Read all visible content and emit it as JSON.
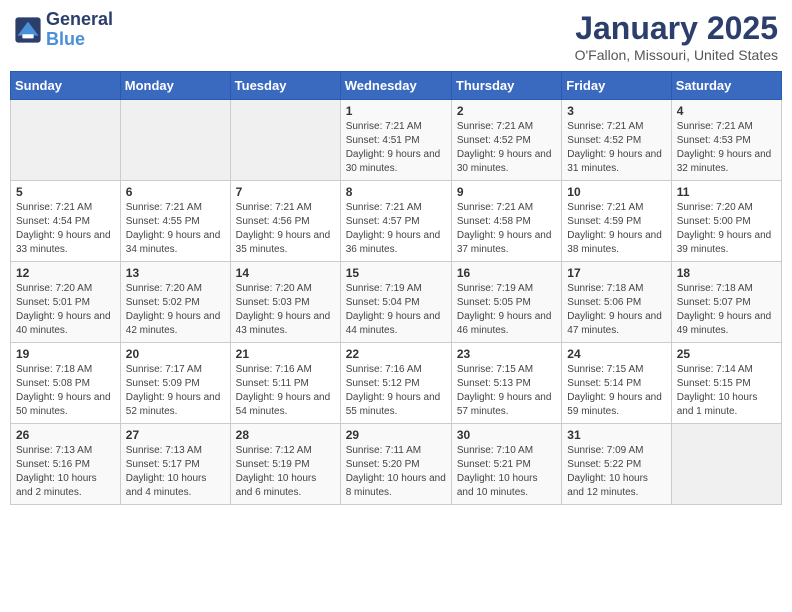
{
  "header": {
    "logo_line1": "General",
    "logo_line2": "Blue",
    "month": "January 2025",
    "location": "O'Fallon, Missouri, United States"
  },
  "weekdays": [
    "Sunday",
    "Monday",
    "Tuesday",
    "Wednesday",
    "Thursday",
    "Friday",
    "Saturday"
  ],
  "weeks": [
    [
      {
        "day": "",
        "info": ""
      },
      {
        "day": "",
        "info": ""
      },
      {
        "day": "",
        "info": ""
      },
      {
        "day": "1",
        "info": "Sunrise: 7:21 AM\nSunset: 4:51 PM\nDaylight: 9 hours and 30 minutes."
      },
      {
        "day": "2",
        "info": "Sunrise: 7:21 AM\nSunset: 4:52 PM\nDaylight: 9 hours and 30 minutes."
      },
      {
        "day": "3",
        "info": "Sunrise: 7:21 AM\nSunset: 4:52 PM\nDaylight: 9 hours and 31 minutes."
      },
      {
        "day": "4",
        "info": "Sunrise: 7:21 AM\nSunset: 4:53 PM\nDaylight: 9 hours and 32 minutes."
      }
    ],
    [
      {
        "day": "5",
        "info": "Sunrise: 7:21 AM\nSunset: 4:54 PM\nDaylight: 9 hours and 33 minutes."
      },
      {
        "day": "6",
        "info": "Sunrise: 7:21 AM\nSunset: 4:55 PM\nDaylight: 9 hours and 34 minutes."
      },
      {
        "day": "7",
        "info": "Sunrise: 7:21 AM\nSunset: 4:56 PM\nDaylight: 9 hours and 35 minutes."
      },
      {
        "day": "8",
        "info": "Sunrise: 7:21 AM\nSunset: 4:57 PM\nDaylight: 9 hours and 36 minutes."
      },
      {
        "day": "9",
        "info": "Sunrise: 7:21 AM\nSunset: 4:58 PM\nDaylight: 9 hours and 37 minutes."
      },
      {
        "day": "10",
        "info": "Sunrise: 7:21 AM\nSunset: 4:59 PM\nDaylight: 9 hours and 38 minutes."
      },
      {
        "day": "11",
        "info": "Sunrise: 7:20 AM\nSunset: 5:00 PM\nDaylight: 9 hours and 39 minutes."
      }
    ],
    [
      {
        "day": "12",
        "info": "Sunrise: 7:20 AM\nSunset: 5:01 PM\nDaylight: 9 hours and 40 minutes."
      },
      {
        "day": "13",
        "info": "Sunrise: 7:20 AM\nSunset: 5:02 PM\nDaylight: 9 hours and 42 minutes."
      },
      {
        "day": "14",
        "info": "Sunrise: 7:20 AM\nSunset: 5:03 PM\nDaylight: 9 hours and 43 minutes."
      },
      {
        "day": "15",
        "info": "Sunrise: 7:19 AM\nSunset: 5:04 PM\nDaylight: 9 hours and 44 minutes."
      },
      {
        "day": "16",
        "info": "Sunrise: 7:19 AM\nSunset: 5:05 PM\nDaylight: 9 hours and 46 minutes."
      },
      {
        "day": "17",
        "info": "Sunrise: 7:18 AM\nSunset: 5:06 PM\nDaylight: 9 hours and 47 minutes."
      },
      {
        "day": "18",
        "info": "Sunrise: 7:18 AM\nSunset: 5:07 PM\nDaylight: 9 hours and 49 minutes."
      }
    ],
    [
      {
        "day": "19",
        "info": "Sunrise: 7:18 AM\nSunset: 5:08 PM\nDaylight: 9 hours and 50 minutes."
      },
      {
        "day": "20",
        "info": "Sunrise: 7:17 AM\nSunset: 5:09 PM\nDaylight: 9 hours and 52 minutes."
      },
      {
        "day": "21",
        "info": "Sunrise: 7:16 AM\nSunset: 5:11 PM\nDaylight: 9 hours and 54 minutes."
      },
      {
        "day": "22",
        "info": "Sunrise: 7:16 AM\nSunset: 5:12 PM\nDaylight: 9 hours and 55 minutes."
      },
      {
        "day": "23",
        "info": "Sunrise: 7:15 AM\nSunset: 5:13 PM\nDaylight: 9 hours and 57 minutes."
      },
      {
        "day": "24",
        "info": "Sunrise: 7:15 AM\nSunset: 5:14 PM\nDaylight: 9 hours and 59 minutes."
      },
      {
        "day": "25",
        "info": "Sunrise: 7:14 AM\nSunset: 5:15 PM\nDaylight: 10 hours and 1 minute."
      }
    ],
    [
      {
        "day": "26",
        "info": "Sunrise: 7:13 AM\nSunset: 5:16 PM\nDaylight: 10 hours and 2 minutes."
      },
      {
        "day": "27",
        "info": "Sunrise: 7:13 AM\nSunset: 5:17 PM\nDaylight: 10 hours and 4 minutes."
      },
      {
        "day": "28",
        "info": "Sunrise: 7:12 AM\nSunset: 5:19 PM\nDaylight: 10 hours and 6 minutes."
      },
      {
        "day": "29",
        "info": "Sunrise: 7:11 AM\nSunset: 5:20 PM\nDaylight: 10 hours and 8 minutes."
      },
      {
        "day": "30",
        "info": "Sunrise: 7:10 AM\nSunset: 5:21 PM\nDaylight: 10 hours and 10 minutes."
      },
      {
        "day": "31",
        "info": "Sunrise: 7:09 AM\nSunset: 5:22 PM\nDaylight: 10 hours and 12 minutes."
      },
      {
        "day": "",
        "info": ""
      }
    ]
  ]
}
